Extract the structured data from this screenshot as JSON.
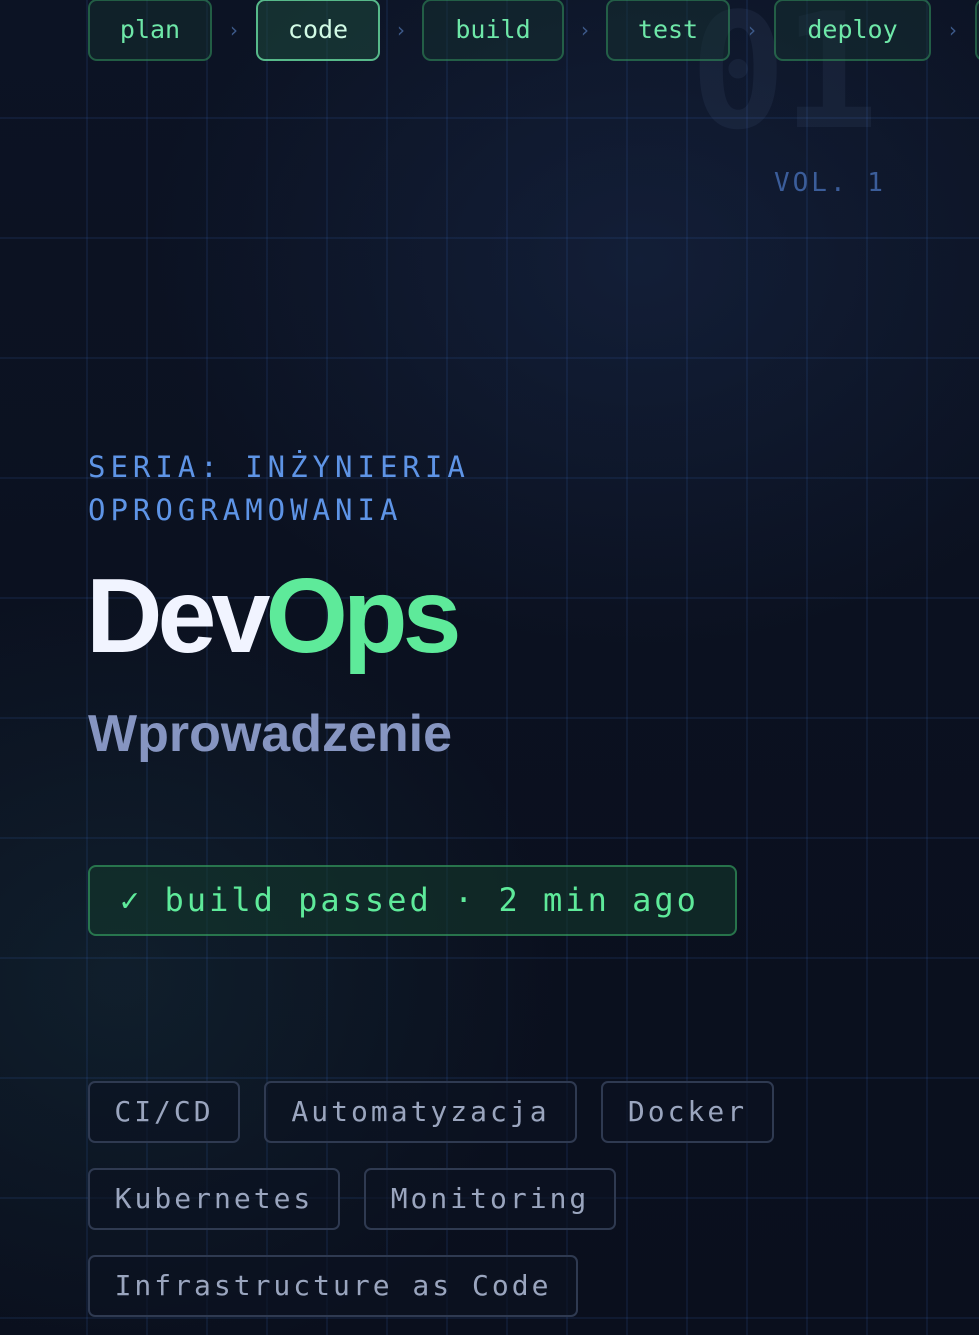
{
  "pipeline": {
    "stages": [
      "plan",
      "code",
      "build",
      "test",
      "deploy",
      ""
    ],
    "active_stage": "code",
    "separator": "›"
  },
  "background": {
    "number": "01"
  },
  "volume": "VOL. 1",
  "series": "SERIA: INŻYNIERIA OPROGRAMOWANIA",
  "title": {
    "part1": "Dev",
    "part2": "Ops"
  },
  "subtitle": "Wprowadzenie",
  "status": {
    "icon": "check-icon",
    "text": "✓ build passed · 2 min ago"
  },
  "tags": [
    "CI/CD",
    "Automatyzacja",
    "Docker",
    "Kubernetes",
    "Monitoring",
    "Infrastructure as Code"
  ],
  "colors": {
    "background": "#0b1120",
    "accent_green": "#5eea9a",
    "accent_blue": "#5e94e6",
    "title_white": "#f1f4ff",
    "subtitle": "#8695c1",
    "tag_text": "#9aa5be"
  }
}
